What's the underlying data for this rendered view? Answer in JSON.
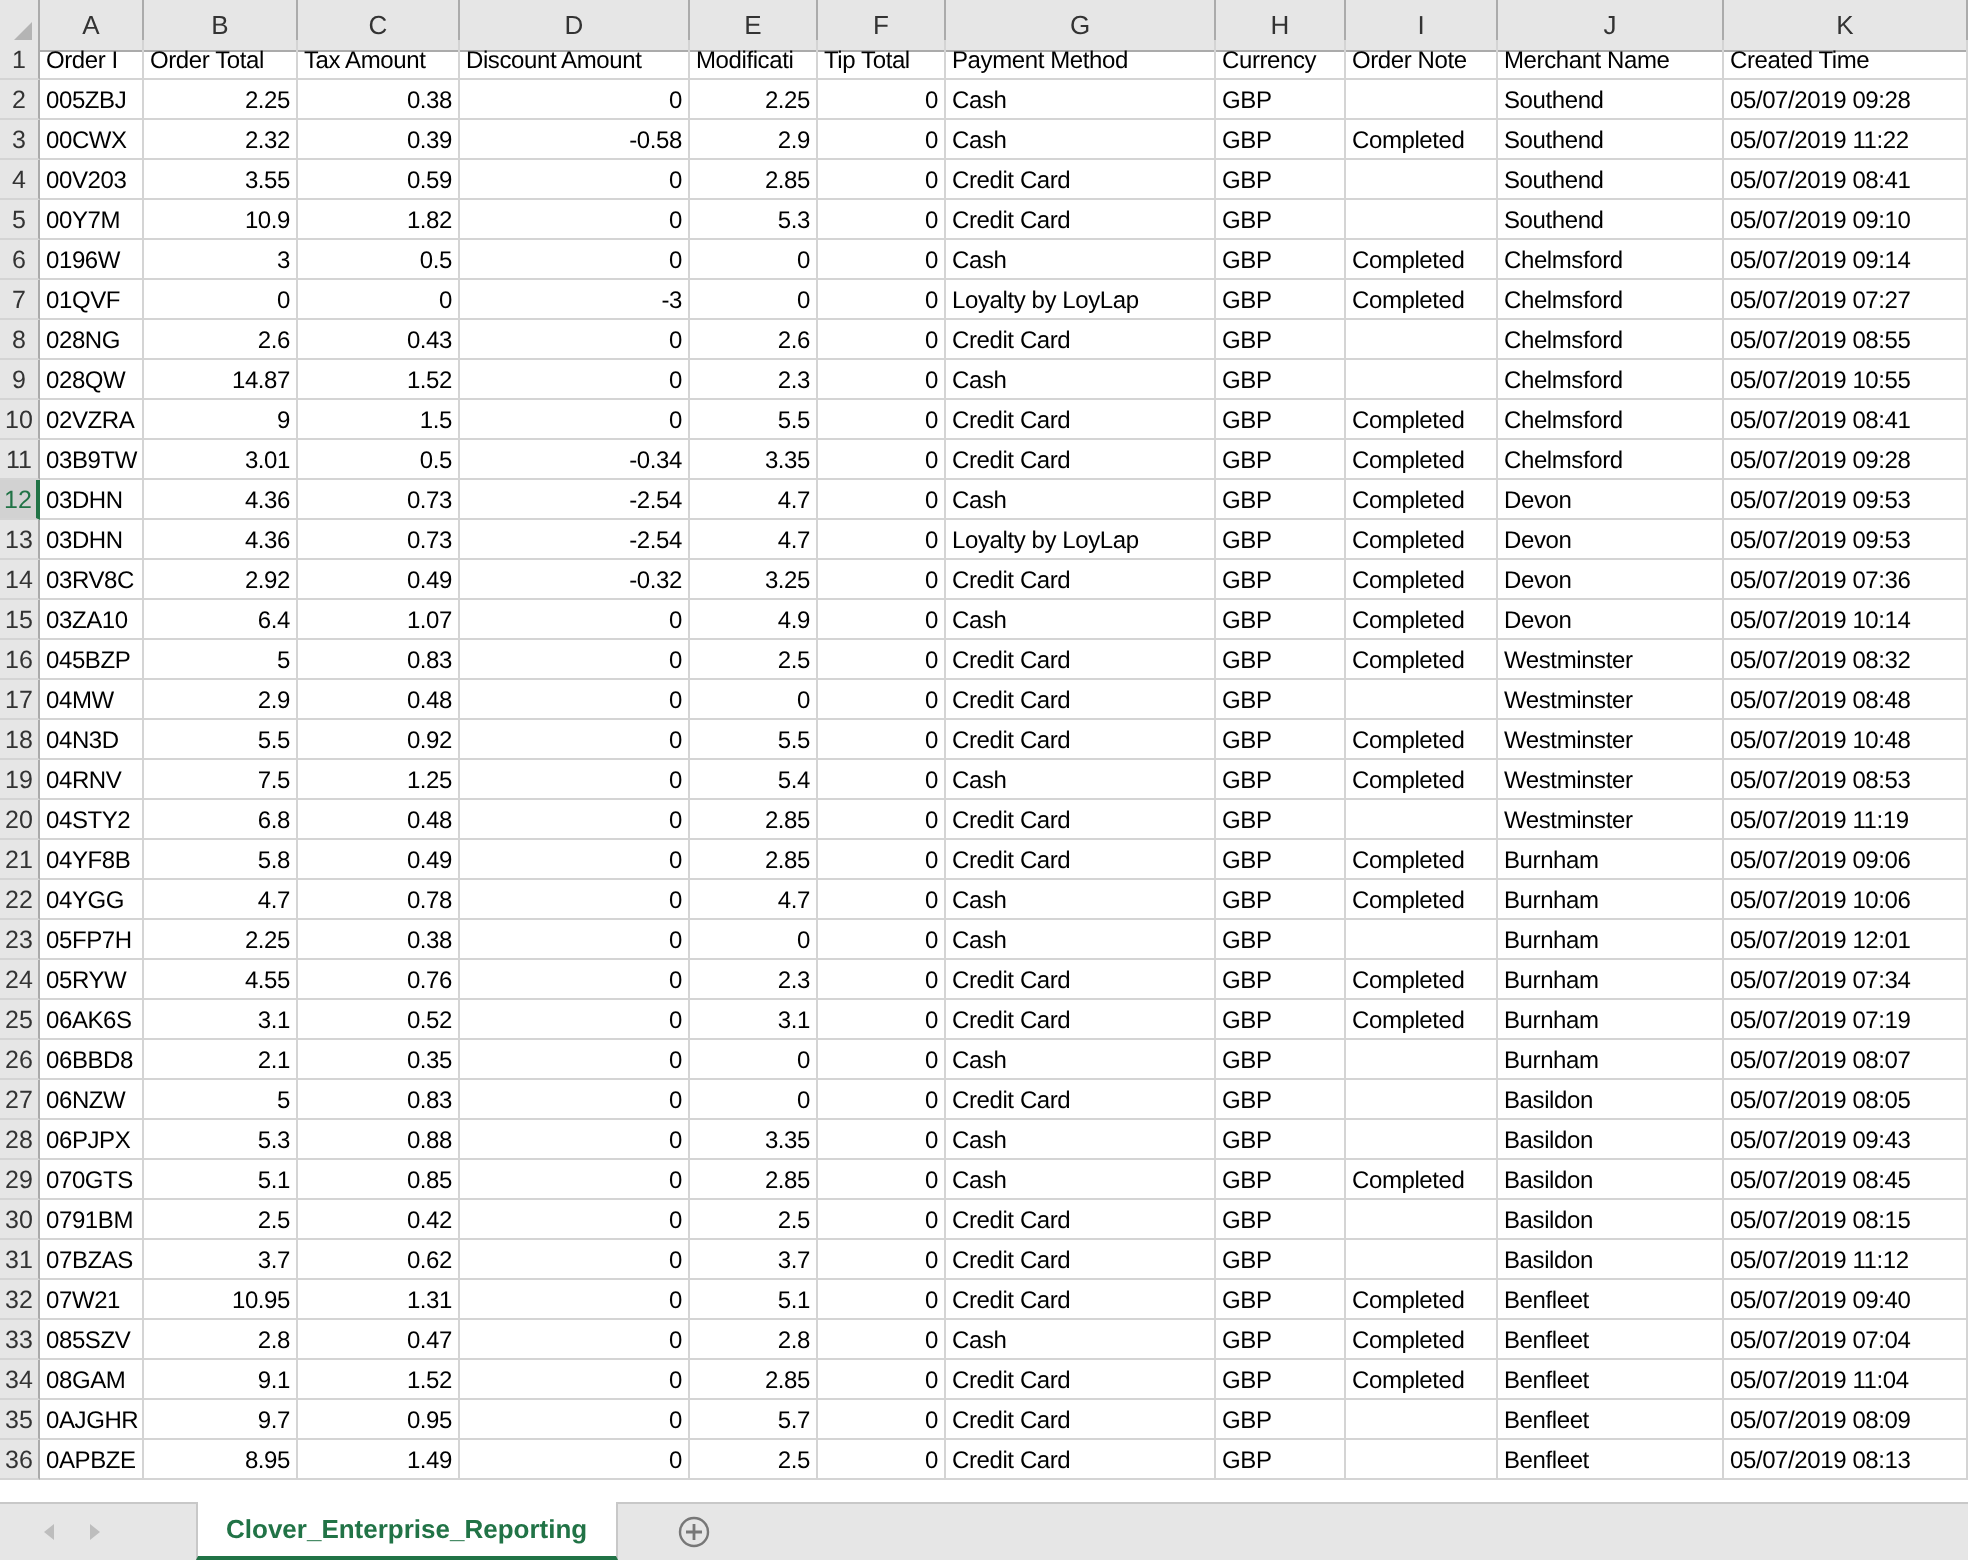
{
  "columns": [
    {
      "letter": "A",
      "kind": "text"
    },
    {
      "letter": "B",
      "kind": "number"
    },
    {
      "letter": "C",
      "kind": "number"
    },
    {
      "letter": "D",
      "kind": "number"
    },
    {
      "letter": "E",
      "kind": "number"
    },
    {
      "letter": "F",
      "kind": "number"
    },
    {
      "letter": "G",
      "kind": "text"
    },
    {
      "letter": "H",
      "kind": "text"
    },
    {
      "letter": "I",
      "kind": "text"
    },
    {
      "letter": "J",
      "kind": "text"
    },
    {
      "letter": "K",
      "kind": "text"
    }
  ],
  "rows": [
    {
      "number": "1",
      "selected": false,
      "cells": [
        "Order I",
        "Order Total",
        "Tax Amount",
        "Discount Amount",
        "Modificati",
        "Tip Total",
        "Payment Method",
        "Currency",
        "Order Note",
        "Merchant Name",
        "Created Time"
      ]
    },
    {
      "number": "2",
      "selected": false,
      "cells": [
        "005ZBJ",
        "2.25",
        "0.38",
        "0",
        "2.25",
        "0",
        "Cash",
        "GBP",
        "",
        "Southend",
        "05/07/2019 09:28"
      ]
    },
    {
      "number": "3",
      "selected": false,
      "cells": [
        "00CWX",
        "2.32",
        "0.39",
        "-0.58",
        "2.9",
        "0",
        "Cash",
        "GBP",
        "Completed",
        "Southend",
        "05/07/2019 11:22"
      ]
    },
    {
      "number": "4",
      "selected": false,
      "cells": [
        "00V203",
        "3.55",
        "0.59",
        "0",
        "2.85",
        "0",
        "Credit Card",
        "GBP",
        "",
        "Southend",
        "05/07/2019 08:41"
      ]
    },
    {
      "number": "5",
      "selected": false,
      "cells": [
        "00Y7M",
        "10.9",
        "1.82",
        "0",
        "5.3",
        "0",
        "Credit Card",
        "GBP",
        "",
        "Southend",
        "05/07/2019 09:10"
      ]
    },
    {
      "number": "6",
      "selected": false,
      "cells": [
        "0196W",
        "3",
        "0.5",
        "0",
        "0",
        "0",
        "Cash",
        "GBP",
        "Completed",
        "Chelmsford",
        "05/07/2019 09:14"
      ]
    },
    {
      "number": "7",
      "selected": false,
      "cells": [
        "01QVF",
        "0",
        "0",
        "-3",
        "0",
        "0",
        "Loyalty by LoyLap",
        "GBP",
        "Completed",
        "Chelmsford",
        "05/07/2019 07:27"
      ]
    },
    {
      "number": "8",
      "selected": false,
      "cells": [
        "028NG",
        "2.6",
        "0.43",
        "0",
        "2.6",
        "0",
        "Credit Card",
        "GBP",
        "",
        "Chelmsford",
        "05/07/2019 08:55"
      ]
    },
    {
      "number": "9",
      "selected": false,
      "cells": [
        "028QW",
        "14.87",
        "1.52",
        "0",
        "2.3",
        "0",
        "Cash",
        "GBP",
        "",
        "Chelmsford",
        "05/07/2019 10:55"
      ]
    },
    {
      "number": "10",
      "selected": false,
      "cells": [
        "02VZRA",
        "9",
        "1.5",
        "0",
        "5.5",
        "0",
        "Credit Card",
        "GBP",
        "Completed",
        "Chelmsford",
        "05/07/2019 08:41"
      ]
    },
    {
      "number": "11",
      "selected": false,
      "cells": [
        "03B9TW",
        "3.01",
        "0.5",
        "-0.34",
        "3.35",
        "0",
        "Credit Card",
        "GBP",
        "Completed",
        "Chelmsford",
        "05/07/2019 09:28"
      ]
    },
    {
      "number": "12",
      "selected": true,
      "cells": [
        "03DHN",
        "4.36",
        "0.73",
        "-2.54",
        "4.7",
        "0",
        "Cash",
        "GBP",
        "Completed",
        "Devon",
        "05/07/2019 09:53"
      ]
    },
    {
      "number": "13",
      "selected": false,
      "cells": [
        "03DHN",
        "4.36",
        "0.73",
        "-2.54",
        "4.7",
        "0",
        "Loyalty by LoyLap",
        "GBP",
        "Completed",
        "Devon",
        "05/07/2019 09:53"
      ]
    },
    {
      "number": "14",
      "selected": false,
      "cells": [
        "03RV8C",
        "2.92",
        "0.49",
        "-0.32",
        "3.25",
        "0",
        "Credit Card",
        "GBP",
        "Completed",
        "Devon",
        "05/07/2019 07:36"
      ]
    },
    {
      "number": "15",
      "selected": false,
      "cells": [
        "03ZA10",
        "6.4",
        "1.07",
        "0",
        "4.9",
        "0",
        "Cash",
        "GBP",
        "Completed",
        "Devon",
        "05/07/2019 10:14"
      ]
    },
    {
      "number": "16",
      "selected": false,
      "cells": [
        "045BZP",
        "5",
        "0.83",
        "0",
        "2.5",
        "0",
        "Credit Card",
        "GBP",
        "Completed",
        "Westminster",
        "05/07/2019 08:32"
      ]
    },
    {
      "number": "17",
      "selected": false,
      "cells": [
        "04MW",
        "2.9",
        "0.48",
        "0",
        "0",
        "0",
        "Credit Card",
        "GBP",
        "",
        "Westminster",
        "05/07/2019 08:48"
      ]
    },
    {
      "number": "18",
      "selected": false,
      "cells": [
        "04N3D",
        "5.5",
        "0.92",
        "0",
        "5.5",
        "0",
        "Credit Card",
        "GBP",
        "Completed",
        "Westminster",
        "05/07/2019 10:48"
      ]
    },
    {
      "number": "19",
      "selected": false,
      "cells": [
        "04RNV",
        "7.5",
        "1.25",
        "0",
        "5.4",
        "0",
        "Cash",
        "GBP",
        "Completed",
        "Westminster",
        "05/07/2019 08:53"
      ]
    },
    {
      "number": "20",
      "selected": false,
      "cells": [
        "04STY2",
        "6.8",
        "0.48",
        "0",
        "2.85",
        "0",
        "Credit Card",
        "GBP",
        "",
        "Westminster",
        "05/07/2019 11:19"
      ]
    },
    {
      "number": "21",
      "selected": false,
      "cells": [
        "04YF8B",
        "5.8",
        "0.49",
        "0",
        "2.85",
        "0",
        "Credit Card",
        "GBP",
        "Completed",
        "Burnham",
        "05/07/2019 09:06"
      ]
    },
    {
      "number": "22",
      "selected": false,
      "cells": [
        "04YGG",
        "4.7",
        "0.78",
        "0",
        "4.7",
        "0",
        "Cash",
        "GBP",
        "Completed",
        "Burnham",
        "05/07/2019 10:06"
      ]
    },
    {
      "number": "23",
      "selected": false,
      "cells": [
        "05FP7H",
        "2.25",
        "0.38",
        "0",
        "0",
        "0",
        "Cash",
        "GBP",
        "",
        "Burnham",
        "05/07/2019 12:01"
      ]
    },
    {
      "number": "24",
      "selected": false,
      "cells": [
        "05RYW",
        "4.55",
        "0.76",
        "0",
        "2.3",
        "0",
        "Credit Card",
        "GBP",
        "Completed",
        "Burnham",
        "05/07/2019 07:34"
      ]
    },
    {
      "number": "25",
      "selected": false,
      "cells": [
        "06AK6S",
        "3.1",
        "0.52",
        "0",
        "3.1",
        "0",
        "Credit Card",
        "GBP",
        "Completed",
        "Burnham",
        "05/07/2019 07:19"
      ]
    },
    {
      "number": "26",
      "selected": false,
      "cells": [
        "06BBD8",
        "2.1",
        "0.35",
        "0",
        "0",
        "0",
        "Cash",
        "GBP",
        "",
        "Burnham",
        "05/07/2019 08:07"
      ]
    },
    {
      "number": "27",
      "selected": false,
      "cells": [
        "06NZW",
        "5",
        "0.83",
        "0",
        "0",
        "0",
        "Credit Card",
        "GBP",
        "",
        "Basildon",
        "05/07/2019 08:05"
      ]
    },
    {
      "number": "28",
      "selected": false,
      "cells": [
        "06PJPX",
        "5.3",
        "0.88",
        "0",
        "3.35",
        "0",
        "Cash",
        "GBP",
        "",
        "Basildon",
        "05/07/2019 09:43"
      ]
    },
    {
      "number": "29",
      "selected": false,
      "cells": [
        "070GTS",
        "5.1",
        "0.85",
        "0",
        "2.85",
        "0",
        "Cash",
        "GBP",
        "Completed",
        "Basildon",
        "05/07/2019 08:45"
      ]
    },
    {
      "number": "30",
      "selected": false,
      "cells": [
        "0791BM",
        "2.5",
        "0.42",
        "0",
        "2.5",
        "0",
        "Credit Card",
        "GBP",
        "",
        "Basildon",
        "05/07/2019 08:15"
      ]
    },
    {
      "number": "31",
      "selected": false,
      "cells": [
        "07BZAS",
        "3.7",
        "0.62",
        "0",
        "3.7",
        "0",
        "Credit Card",
        "GBP",
        "",
        "Basildon",
        "05/07/2019 11:12"
      ]
    },
    {
      "number": "32",
      "selected": false,
      "cells": [
        "07W21",
        "10.95",
        "1.31",
        "0",
        "5.1",
        "0",
        "Credit Card",
        "GBP",
        "Completed",
        "Benfleet",
        "05/07/2019 09:40"
      ]
    },
    {
      "number": "33",
      "selected": false,
      "cells": [
        "085SZV",
        "2.8",
        "0.47",
        "0",
        "2.8",
        "0",
        "Cash",
        "GBP",
        "Completed",
        "Benfleet",
        "05/07/2019 07:04"
      ]
    },
    {
      "number": "34",
      "selected": false,
      "cells": [
        "08GAM",
        "9.1",
        "1.52",
        "0",
        "2.85",
        "0",
        "Credit Card",
        "GBP",
        "Completed",
        "Benfleet",
        "05/07/2019 11:04"
      ]
    },
    {
      "number": "35",
      "selected": false,
      "cells": [
        "0AJGHR",
        "9.7",
        "0.95",
        "0",
        "5.7",
        "0",
        "Credit Card",
        "GBP",
        "",
        "Benfleet",
        "05/07/2019 08:09"
      ]
    },
    {
      "number": "36",
      "selected": false,
      "cells": [
        "0APBZE",
        "8.95",
        "1.49",
        "0",
        "2.5",
        "0",
        "Credit Card",
        "GBP",
        "",
        "Benfleet",
        "05/07/2019 08:13"
      ]
    }
  ],
  "sheet_tabs": [
    {
      "label": "Clover_Enterprise_Reporting",
      "selected": true
    }
  ]
}
